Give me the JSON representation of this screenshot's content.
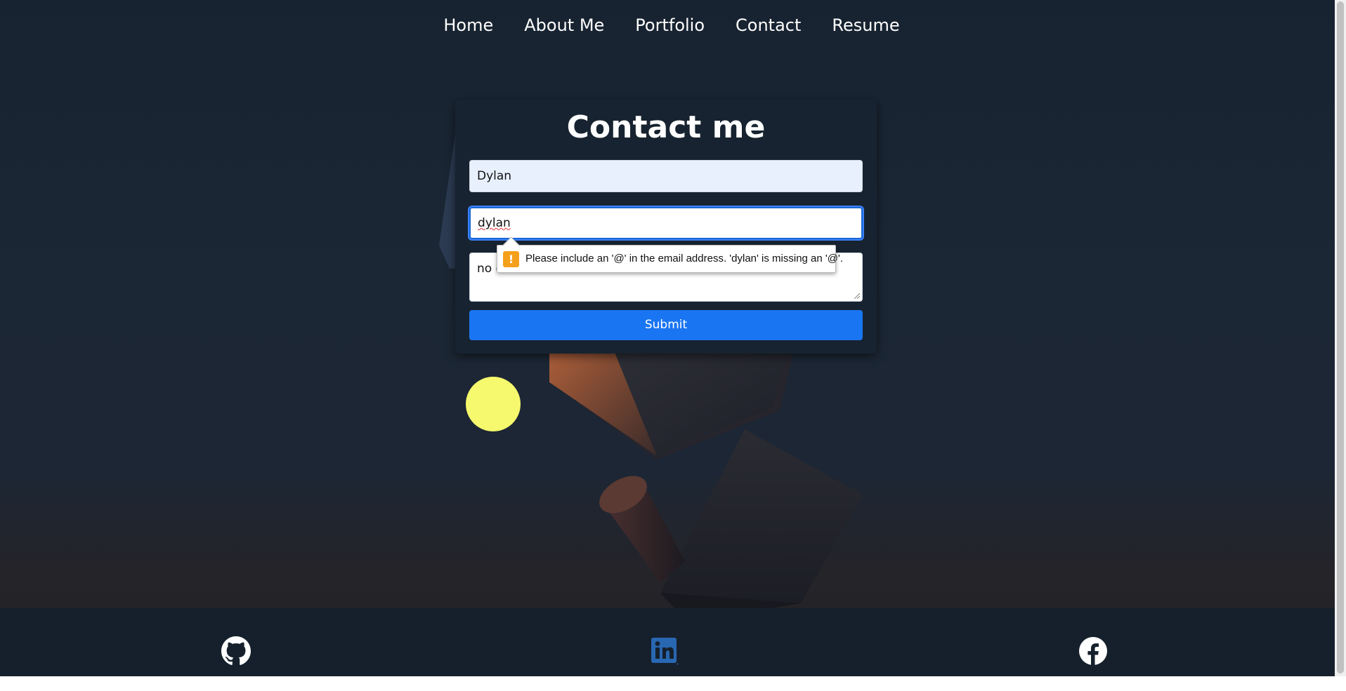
{
  "nav": {
    "items": [
      {
        "label": "Home"
      },
      {
        "label": "About Me"
      },
      {
        "label": "Portfolio"
      },
      {
        "label": "Contact"
      },
      {
        "label": "Resume"
      }
    ]
  },
  "contact_form": {
    "title": "Contact me",
    "name_value": "Dylan",
    "email_value": "dylan",
    "message_value": "no e",
    "submit_label": "Submit"
  },
  "validation_tooltip": {
    "message": "Please include an '@' in the email address. 'dylan' is missing an '@'.",
    "icon": "warning-icon",
    "icon_glyph": "!"
  },
  "footer": {
    "social_links": [
      {
        "icon": "github-icon"
      },
      {
        "icon": "linkedin-icon"
      },
      {
        "icon": "facebook-icon"
      }
    ]
  },
  "colors": {
    "background": "#1b2735",
    "card": "#172330",
    "submit": "#1a75f2",
    "footer": "#15202c",
    "linkedin": "#2867b2",
    "warning": "#f5a01a",
    "sun": "#f6f86d"
  }
}
